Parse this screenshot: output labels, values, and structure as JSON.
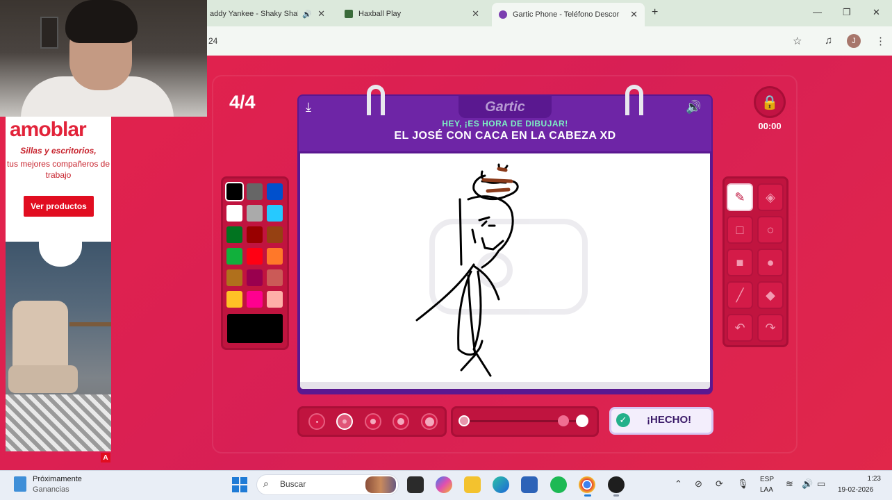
{
  "browser": {
    "tabs": [
      {
        "label": "addy Yankee - Shaky Shak",
        "playing": true
      },
      {
        "label": "Haxball Play"
      },
      {
        "label": "Gartic Phone - Teléfono Descor",
        "active": true
      }
    ],
    "url_fragment": "24",
    "profile_initial": "J"
  },
  "ad": {
    "brand": "amoblar",
    "tagline": "Sillas y escritorios,",
    "subline": "tus mejores compañeros de trabajo",
    "cta": "Ver productos",
    "adchoices": "A"
  },
  "game": {
    "round": "4/4",
    "logo": "Gartic",
    "hint": "HEY, ¡ES HORA DE DIBUJAR!",
    "theme": "EL JOSÉ CON CACA EN LA CABEZA XD",
    "timer": "00:00",
    "done_label": "¡HECHO!",
    "palette": [
      "#000000",
      "#666666",
      "#0050cd",
      "#ffffff",
      "#aaaaaa",
      "#26c9ff",
      "#017420",
      "#990000",
      "#964112",
      "#11b03c",
      "#ff0013",
      "#ff7829",
      "#b0701c",
      "#99004e",
      "#cb5a57",
      "#ffc126",
      "#ff008f",
      "#feafa8"
    ],
    "selected_color": "#000000",
    "tools": [
      "pencil-icon",
      "eraser-icon",
      "rectangle-outline-icon",
      "circle-outline-icon",
      "rectangle-filled-icon",
      "circle-filled-icon",
      "line-icon",
      "fill-bucket-icon",
      "undo-icon",
      "redo-icon"
    ],
    "selected_tool": "pencil-icon",
    "brush_sizes": 5,
    "selected_brush_size": 2,
    "opacity_level": 1.0
  },
  "taskbar": {
    "weather_title": "Próximamente",
    "weather_sub": "Ganancias",
    "search_placeholder": "Buscar",
    "lang_1": "ESP",
    "lang_2": "LAA",
    "time": "1:23",
    "date": "19-02-2026"
  }
}
